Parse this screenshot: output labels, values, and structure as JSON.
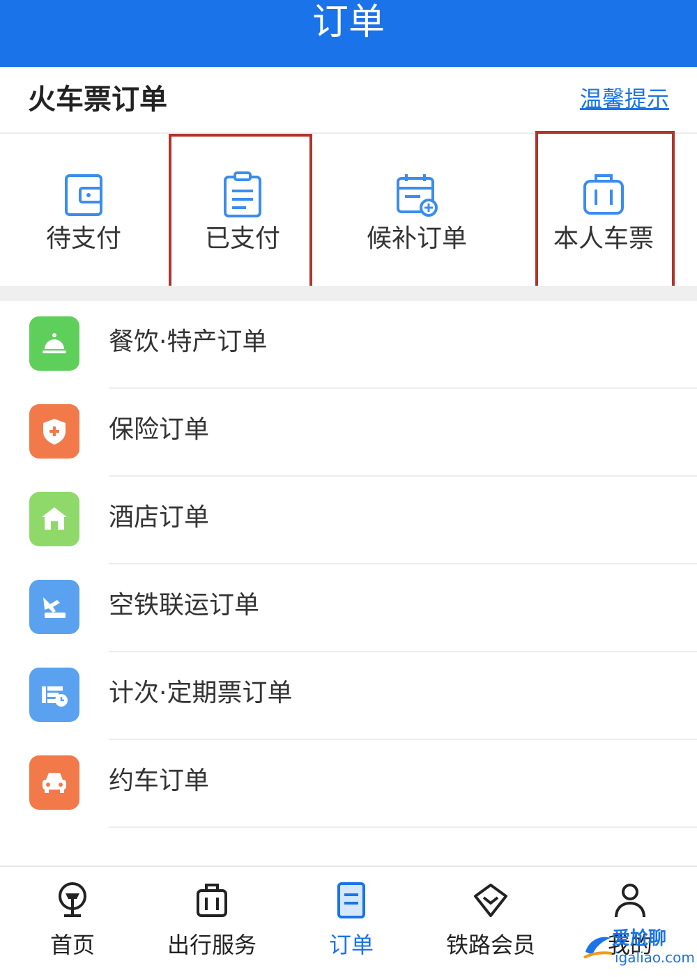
{
  "header": {
    "title": "订单"
  },
  "section": {
    "title": "火车票订单",
    "hint_link": "温馨提示"
  },
  "quick_actions": [
    {
      "label": "待支付",
      "icon": "wallet-icon",
      "highlighted": false
    },
    {
      "label": "已支付",
      "icon": "clipboard-icon",
      "highlighted": true
    },
    {
      "label": "候补订单",
      "icon": "calendar-add-icon",
      "highlighted": false
    },
    {
      "label": "本人车票",
      "icon": "suitcase-icon",
      "highlighted": true
    }
  ],
  "orders": [
    {
      "label": "餐饮·特产订单",
      "icon": "service-bell-icon",
      "color": "#5fcf5b"
    },
    {
      "label": "保险订单",
      "icon": "shield-plus-icon",
      "color": "#f27a4a"
    },
    {
      "label": "酒店订单",
      "icon": "hotel-icon",
      "color": "#8fd96a"
    },
    {
      "label": "空铁联运订单",
      "icon": "plane-train-icon",
      "color": "#5aa2f0"
    },
    {
      "label": "计次·定期票订单",
      "icon": "ticket-clock-icon",
      "color": "#5aa2f0"
    },
    {
      "label": "约车订单",
      "icon": "car-icon",
      "color": "#f27a4a"
    }
  ],
  "bottom_nav": [
    {
      "label": "首页",
      "icon": "railway-logo-icon",
      "active": false
    },
    {
      "label": "出行服务",
      "icon": "luggage-icon",
      "active": false
    },
    {
      "label": "订单",
      "icon": "order-doc-icon",
      "active": true
    },
    {
      "label": "铁路会员",
      "icon": "diamond-icon",
      "active": false
    },
    {
      "label": "我的",
      "icon": "person-icon",
      "active": false
    }
  ],
  "watermark": {
    "text": "爱尬聊",
    "url": "igaliao.com"
  },
  "colors": {
    "primary": "#1a73e8",
    "highlight_box": "#b0342b"
  }
}
